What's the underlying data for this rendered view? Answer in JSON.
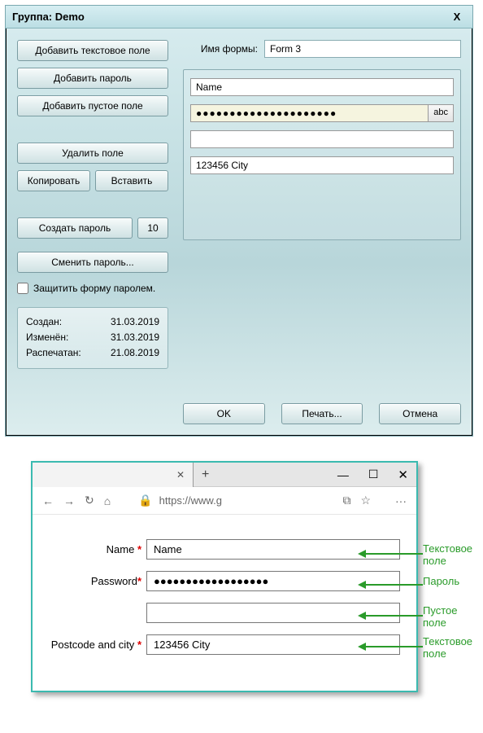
{
  "dialog": {
    "title": "Группа: Demo",
    "close": "X",
    "buttons": {
      "add_text": "Добавить текстовое поле",
      "add_password": "Добавить пароль",
      "add_empty": "Добавить пустое поле",
      "delete_field": "Удалить поле",
      "copy": "Копировать",
      "paste": "Вставить",
      "gen_password": "Создать пароль",
      "gen_len": "10",
      "change_password": "Сменить пароль...",
      "protect": "Защитить форму паролем.",
      "ok": "OK",
      "print": "Печать...",
      "cancel": "Отмена"
    },
    "meta": {
      "created_lbl": "Создан:",
      "created": "31.03.2019",
      "changed_lbl": "Изменён:",
      "changed": "31.03.2019",
      "printed_lbl": "Распечатан:",
      "printed": "21.08.2019"
    },
    "form_name_lbl": "Имя формы:",
    "form_name": "Form 3",
    "fields": {
      "f1": "Name",
      "f2": "●●●●●●●●●●●●●●●●●●●●●",
      "abc": "abc",
      "f3": "",
      "f4": "123456 City"
    }
  },
  "browser": {
    "tab_x": "✕",
    "plus": "+",
    "min": "—",
    "max": "☐",
    "close": "✕",
    "back": "←",
    "fwd": "→",
    "reload": "↻",
    "home": "⌂",
    "lock": "🔒",
    "url": "https://www.g",
    "book": "⧉",
    "star": "☆",
    "more": "···",
    "labels": {
      "name": "Name",
      "password": "Password",
      "postcode": "Postcode and city"
    },
    "values": {
      "name": "Name",
      "password": "●●●●●●●●●●●●●●●●●●",
      "empty": "",
      "postcode": "123456 City"
    },
    "callouts": {
      "text_field": "Текстовое\nполе",
      "password": "Пароль",
      "empty_field": "Пустое\nполе",
      "text_field2": "Текстовое\nполе"
    }
  }
}
